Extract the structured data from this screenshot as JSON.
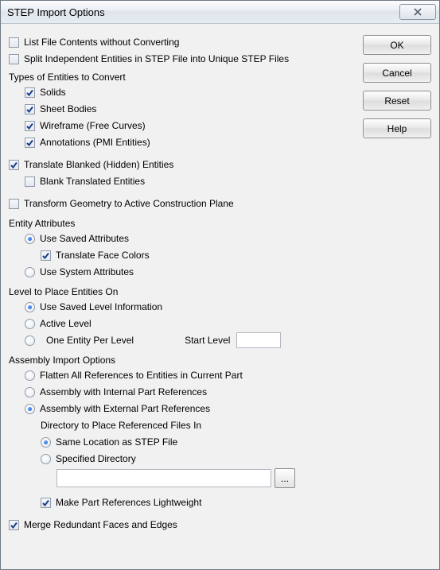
{
  "title": "STEP Import Options",
  "buttons": {
    "ok": "OK",
    "cancel": "Cancel",
    "reset": "Reset",
    "help": "Help"
  },
  "top": {
    "list_without_converting": "List File Contents without Converting",
    "split_independent": "Split Independent Entities in STEP File into Unique STEP Files"
  },
  "types_label": "Types of Entities to Convert",
  "types": {
    "solids": "Solids",
    "sheet_bodies": "Sheet Bodies",
    "wireframe": "Wireframe (Free Curves)",
    "annotations": "Annotations (PMI Entities)"
  },
  "translate_blanked": "Translate Blanked (Hidden) Entities",
  "blank_translated": "Blank Translated Entities",
  "transform_geometry": "Transform Geometry to Active Construction Plane",
  "entity_attrs_label": "Entity Attributes",
  "entity_attrs": {
    "use_saved": "Use Saved Attributes",
    "translate_face_colors": "Translate Face Colors",
    "use_system": "Use System Attributes"
  },
  "level_label": "Level to Place Entities On",
  "level": {
    "use_saved": "Use Saved Level Information",
    "active": "Active Level",
    "one_per": "One Entity Per Level",
    "start_level_label": "Start Level",
    "start_level_value": ""
  },
  "assembly_label": "Assembly Import Options",
  "assembly": {
    "flatten": "Flatten All References to Entities in Current Part",
    "internal": "Assembly with Internal Part References",
    "external": "Assembly with External Part References",
    "dir_label": "Directory to Place Referenced Files In",
    "same_location": "Same Location as STEP File",
    "specified_dir": "Specified Directory",
    "dir_value": "",
    "browse": "...",
    "make_lightweight": "Make Part References Lightweight"
  },
  "merge_redundant": "Merge Redundant Faces and Edges"
}
